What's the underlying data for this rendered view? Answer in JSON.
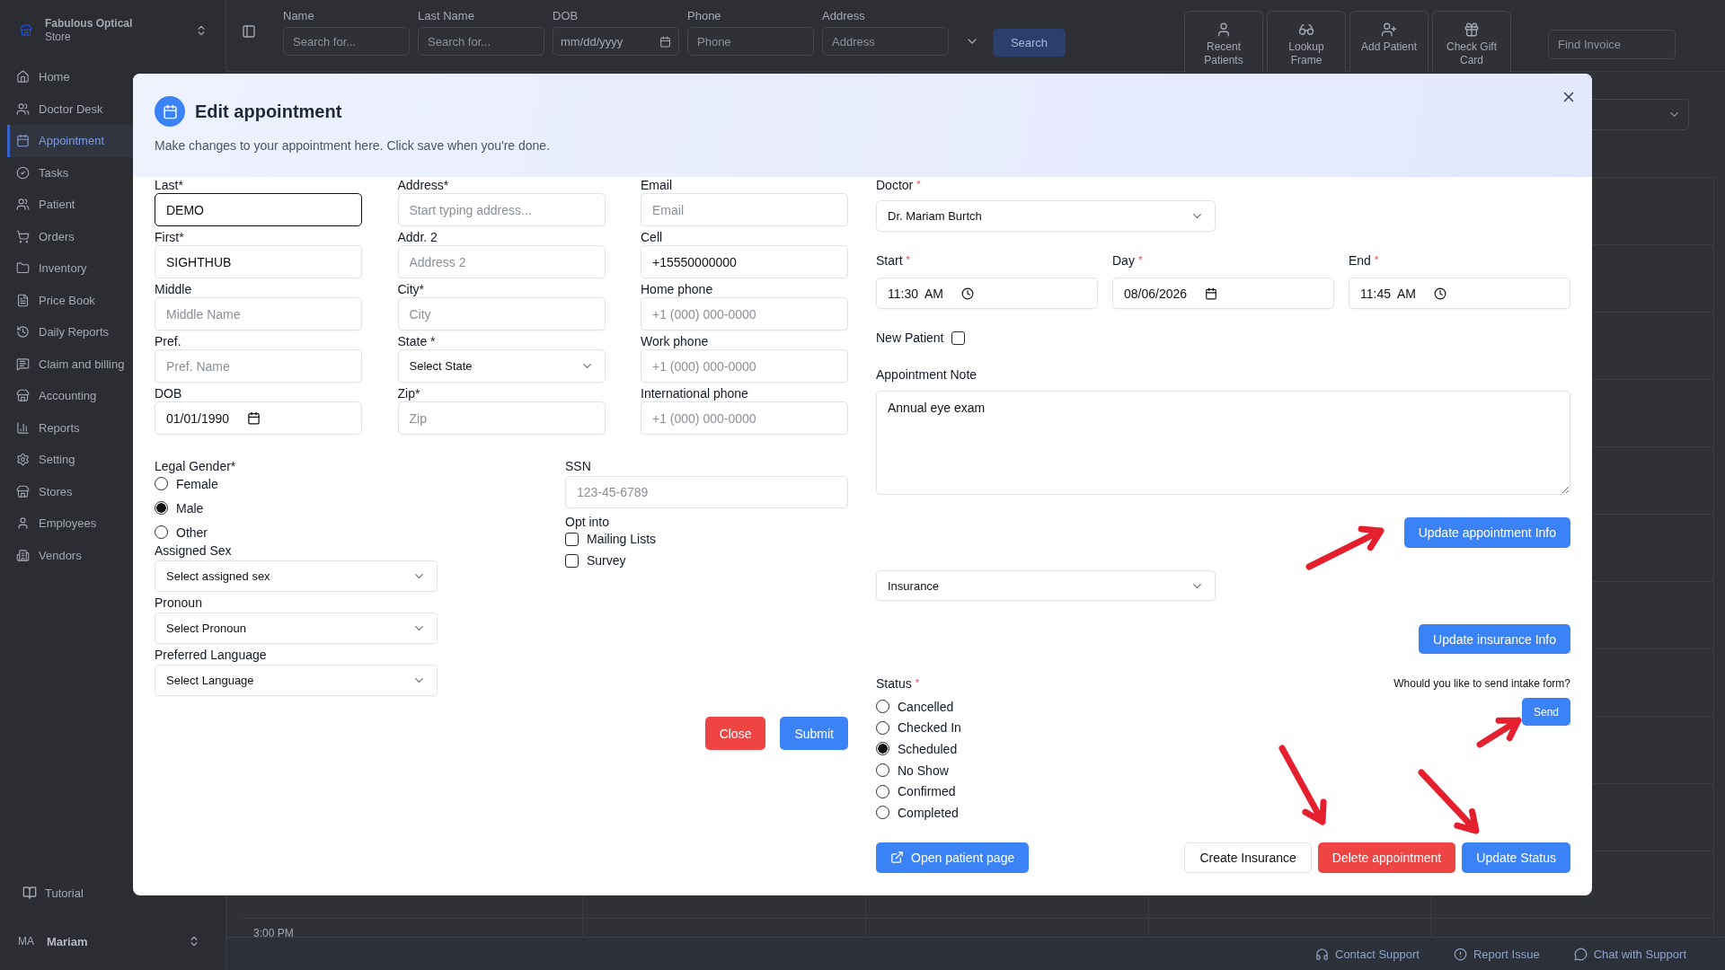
{
  "store": {
    "name": "Fabulous Optical",
    "subtitle": "Store"
  },
  "sidebar": {
    "items": [
      {
        "label": "Home",
        "selected": false
      },
      {
        "label": "Doctor Desk",
        "selected": false
      },
      {
        "label": "Appointment",
        "selected": true
      },
      {
        "label": "Tasks",
        "selected": false
      },
      {
        "label": "Patient",
        "selected": false
      },
      {
        "label": "Orders",
        "selected": false
      },
      {
        "label": "Inventory",
        "selected": false
      },
      {
        "label": "Price Book",
        "selected": false
      },
      {
        "label": "Daily Reports",
        "selected": false
      },
      {
        "label": "Claim and billing",
        "selected": false
      },
      {
        "label": "Accounting",
        "selected": false
      },
      {
        "label": "Reports",
        "selected": false
      },
      {
        "label": "Setting",
        "selected": false
      },
      {
        "label": "Stores",
        "selected": false
      },
      {
        "label": "Employees",
        "selected": false
      },
      {
        "label": "Vendors",
        "selected": false
      }
    ],
    "tutorial": "Tutorial",
    "user": {
      "initials": "MA",
      "name": "Mariam"
    }
  },
  "search": {
    "fields": [
      {
        "label": "Name",
        "placeholder": "Search for...",
        "kind": "text"
      },
      {
        "label": "Last Name",
        "placeholder": "Search for...",
        "kind": "text"
      },
      {
        "label": "DOB",
        "placeholder": "mm/dd/yyyy",
        "kind": "date"
      },
      {
        "label": "Phone",
        "placeholder": "Phone",
        "kind": "text"
      },
      {
        "label": "Address",
        "placeholder": "Address",
        "kind": "text"
      }
    ],
    "button": "Search"
  },
  "quick_actions": [
    {
      "label": "Recent Patients"
    },
    {
      "label": "Lookup Frame"
    },
    {
      "label": "Add Patient"
    },
    {
      "label": "Check Gift Card"
    }
  ],
  "invoice_search": {
    "placeholder": "Find Invoice"
  },
  "calendar": {
    "time_label": "3:00 PM"
  },
  "footer_links": [
    {
      "label": "Contact Support"
    },
    {
      "label": "Report Issue"
    },
    {
      "label": "Chat with Support"
    }
  ],
  "dialog": {
    "title": "Edit appointment",
    "description": "Make changes to your appointment here. Click save when you're done.",
    "patient_columns": [
      [
        {
          "label": "Last*",
          "value": "DEMO",
          "kind": "text",
          "focused": true
        },
        {
          "label": "First*",
          "value": "SIGHTHUB",
          "kind": "text",
          "focused": false
        },
        {
          "label": "Middle",
          "placeholder": "Middle Name",
          "kind": "text",
          "focused": false
        },
        {
          "label": "Pref.",
          "placeholder": "Pref. Name",
          "kind": "text",
          "focused": false
        },
        {
          "label": "DOB",
          "value": "01/01/1990",
          "kind": "date",
          "focused": false
        }
      ],
      [
        {
          "label": "Address*",
          "placeholder": "Start typing address...",
          "kind": "text",
          "focused": false
        },
        {
          "label": "Addr. 2",
          "placeholder": "Address 2",
          "kind": "text",
          "focused": false
        },
        {
          "label": "City*",
          "placeholder": "City",
          "kind": "text",
          "focused": false
        },
        {
          "label": "State *",
          "value": "Select State",
          "kind": "select",
          "focused": false
        },
        {
          "label": "Zip*",
          "placeholder": "Zip",
          "kind": "text",
          "focused": false
        }
      ],
      [
        {
          "label": "Email",
          "placeholder": "Email",
          "kind": "text",
          "focused": false
        },
        {
          "label": "Cell",
          "value": "+15550000000",
          "kind": "text",
          "focused": false
        },
        {
          "label": "Home phone",
          "placeholder": "+1 (000) 000-0000",
          "kind": "text",
          "focused": false
        },
        {
          "label": "Work phone",
          "placeholder": "+1 (000) 000-0000",
          "kind": "text",
          "focused": false
        },
        {
          "label": "International phone",
          "placeholder": "+1 (000) 000-0000",
          "kind": "text",
          "focused": false
        }
      ]
    ],
    "legal_gender": {
      "label": "Legal Gender*",
      "options": [
        {
          "label": "Female",
          "selected": false
        },
        {
          "label": "Male",
          "selected": true
        },
        {
          "label": "Other",
          "selected": false
        }
      ]
    },
    "selects": [
      {
        "label": "Assigned Sex",
        "value": "Select assigned sex"
      },
      {
        "label": "Pronoun",
        "value": "Select Pronoun"
      },
      {
        "label": "Preferred Language",
        "value": "Select Language"
      }
    ],
    "ssn": {
      "label": "SSN",
      "placeholder": "123-45-6789"
    },
    "opt_into": {
      "label": "Opt into",
      "options": [
        {
          "label": "Mailing Lists",
          "checked": false
        },
        {
          "label": "Survey",
          "checked": false
        }
      ]
    },
    "close_button": "Close",
    "submit_button": "Submit",
    "doctor": {
      "label": "Doctor",
      "mark": "*",
      "value": "Dr. Mariam Burtch"
    },
    "times": [
      {
        "label": "Start",
        "mark": "*",
        "value": "11:30  AM",
        "kind": "time"
      },
      {
        "label": "Day",
        "mark": "*",
        "value": "08/06/2026",
        "kind": "date"
      },
      {
        "label": "End",
        "mark": "*",
        "value": "11:45  AM",
        "kind": "time"
      }
    ],
    "new_patient": {
      "label": "New Patient",
      "checked": false
    },
    "note": {
      "label": "Appointment Note",
      "value": "Annual eye exam"
    },
    "update_appointment_button": "Update appointment Info",
    "insurance": {
      "value": "Insurance"
    },
    "update_insurance_button": "Update insurance Info",
    "status": {
      "label": "Status",
      "mark": "*",
      "options": [
        {
          "label": "Cancelled",
          "selected": false
        },
        {
          "label": "Checked In",
          "selected": false
        },
        {
          "label": "Scheduled",
          "selected": true
        },
        {
          "label": "No Show",
          "selected": false
        },
        {
          "label": "Confirmed",
          "selected": false
        },
        {
          "label": "Completed",
          "selected": false
        }
      ]
    },
    "intake": {
      "question": "Whould you like to send intake form?",
      "button": "Send"
    },
    "actions": [
      {
        "label": "Open patient page",
        "kind": "link"
      },
      {
        "label": "Create Insurance",
        "kind": "outline"
      },
      {
        "label": "Delete appointment",
        "kind": "danger"
      },
      {
        "label": "Update Status",
        "kind": "primary"
      }
    ]
  }
}
